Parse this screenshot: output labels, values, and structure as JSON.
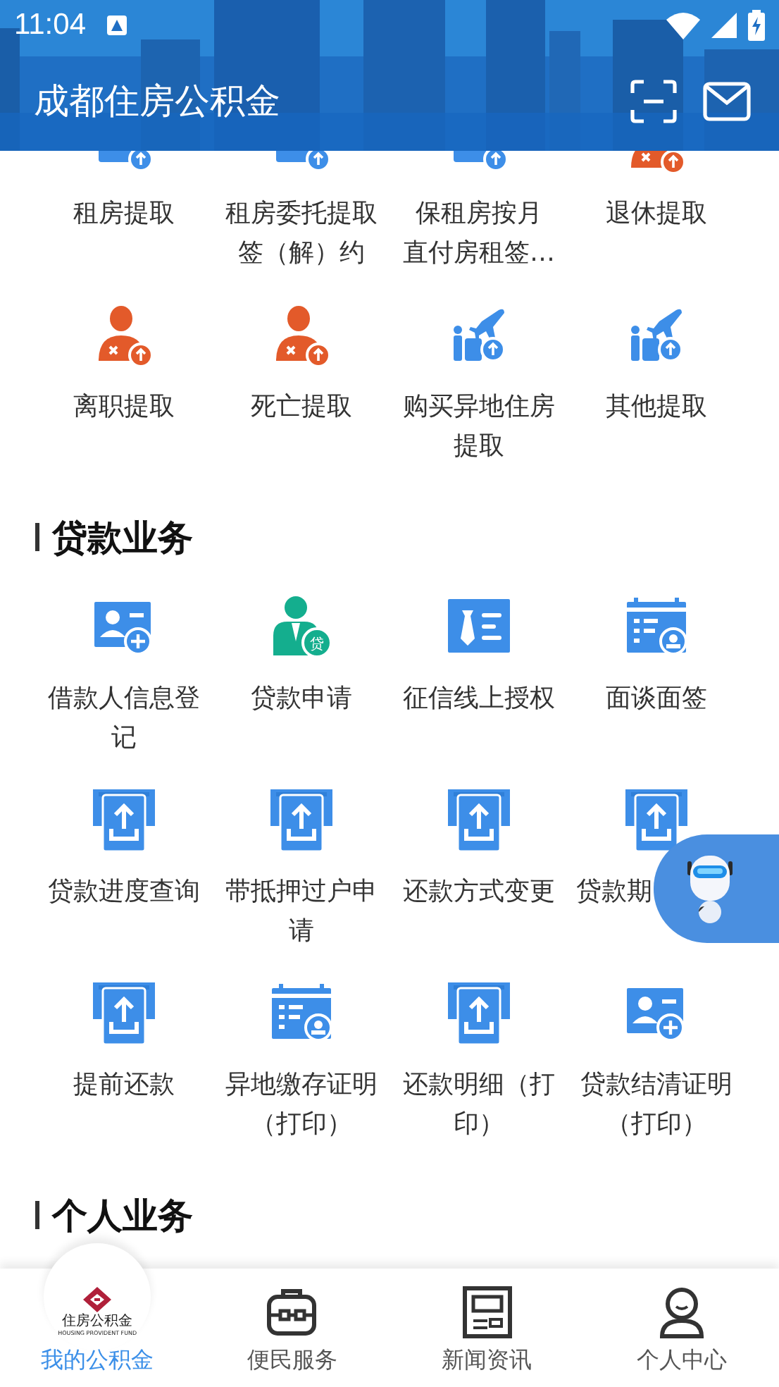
{
  "status_bar": {
    "time": "11:04"
  },
  "app_bar": {
    "title": "成都住房公积金"
  },
  "sections": [
    {
      "items": [
        {
          "label": "租房提取",
          "kind": "card-up"
        },
        {
          "label": "租房委托提取签（解）约",
          "kind": "card-up"
        },
        {
          "lines": [
            "保租房按月",
            "直付房租签…"
          ],
          "kind": "card-up"
        },
        {
          "label": "退休提取",
          "kind": "person-x"
        },
        {
          "label": "离职提取",
          "kind": "person-x"
        },
        {
          "label": "死亡提取",
          "kind": "person-x"
        },
        {
          "label": "购买异地住房提取",
          "kind": "travel"
        },
        {
          "label": "其他提取",
          "kind": "travel"
        }
      ]
    },
    {
      "title": "贷款业务",
      "items": [
        {
          "label": "借款人信息登记",
          "kind": "card-add"
        },
        {
          "label": "贷款申请",
          "kind": "loan-person",
          "badge": "贷"
        },
        {
          "label": "征信线上授权",
          "kind": "id-card"
        },
        {
          "label": "面谈面签",
          "kind": "calendar"
        },
        {
          "label": "贷款进度查询",
          "kind": "tray-up"
        },
        {
          "label": "带抵押过户申请",
          "kind": "tray-up"
        },
        {
          "label": "还款方式变更",
          "kind": "tray-up"
        },
        {
          "label": "贷款期",
          "kind": "tray-up",
          "cut": true
        },
        {
          "label": "提前还款",
          "kind": "tray-up"
        },
        {
          "label": "异地缴存证明（打印）",
          "kind": "calendar"
        },
        {
          "label": "还款明细（打印）",
          "kind": "tray-up"
        },
        {
          "label": "贷款结清证明（打印）",
          "kind": "card-add"
        }
      ]
    },
    {
      "title": "个人业务"
    }
  ],
  "tabs": [
    {
      "label": "我的公积金",
      "kind": "logo",
      "logo_text": "住房公积金",
      "logo_subtext": "HOUSING PROVIDENT FUND",
      "selected": true
    },
    {
      "label": "便民服务",
      "kind": "briefcase",
      "selected": false
    },
    {
      "label": "新闻资讯",
      "kind": "news",
      "selected": false
    },
    {
      "label": "个人中心",
      "kind": "person",
      "selected": false
    }
  ]
}
